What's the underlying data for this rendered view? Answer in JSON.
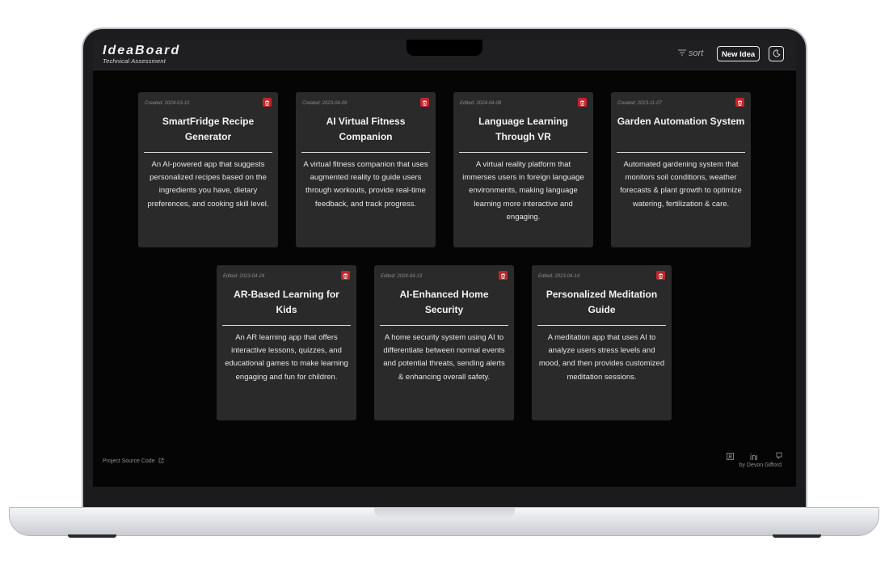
{
  "app": {
    "title": "IdeaBoard",
    "subtitle": "Technical Assessment"
  },
  "header": {
    "sort_label": "sort",
    "new_idea_label": "New Idea",
    "theme_icon": "moon-icon",
    "sort_icon": "sort-lines-icon"
  },
  "cards": [
    {
      "date": "Created: 2024-03-10",
      "title": "SmartFridge Recipe Generator",
      "description": "An AI-powered app that suggests personalized recipes based on the ingredients you have, dietary preferences, and cooking skill level."
    },
    {
      "date": "Created: 2023-04-09",
      "title": "AI Virtual Fitness Companion",
      "description": "A virtual fitness companion that uses augmented reality to guide users through workouts, provide real-time feedback, and track progress."
    },
    {
      "date": "Edited: 2024-04-08",
      "title": "Language Learning Through VR",
      "description": "A virtual reality platform that immerses users in foreign language environments, making language learning more interactive and engaging."
    },
    {
      "date": "Created: 2023-11-07",
      "title": "Garden Automation System",
      "description": "Automated gardening system that monitors soil conditions, weather forecasts & plant growth to optimize watering, fertilization & care."
    },
    {
      "date": "Edited: 2023-04-24",
      "title": "AR-Based Learning for Kids",
      "description": "An AR learning app that offers interactive lessons, quizzes, and educational games to make learning engaging and fun for children."
    },
    {
      "date": "Edited: 2024-04-13",
      "title": "AI-Enhanced Home Security",
      "description": "A home security system using AI to differentiate between normal events and potential threats, sending alerts & enhancing overall safety."
    },
    {
      "date": "Edited: 2023-04-14",
      "title": "Personalized Meditation Guide",
      "description": "A meditation app that uses AI to analyze users stress levels and mood, and then provides customized meditation sessions."
    }
  ],
  "footer": {
    "source_link": "Project Source Code",
    "author": "by Devon Gifford",
    "social_icons": [
      "portfolio-icon",
      "linkedin-icon",
      "github-icon"
    ]
  },
  "colors": {
    "background": "#050505",
    "header": "#1f1f21",
    "card": "#2a2a2b",
    "delete_button": "#c0262c",
    "text": "#f3f3f3",
    "muted": "#8f8f92"
  }
}
